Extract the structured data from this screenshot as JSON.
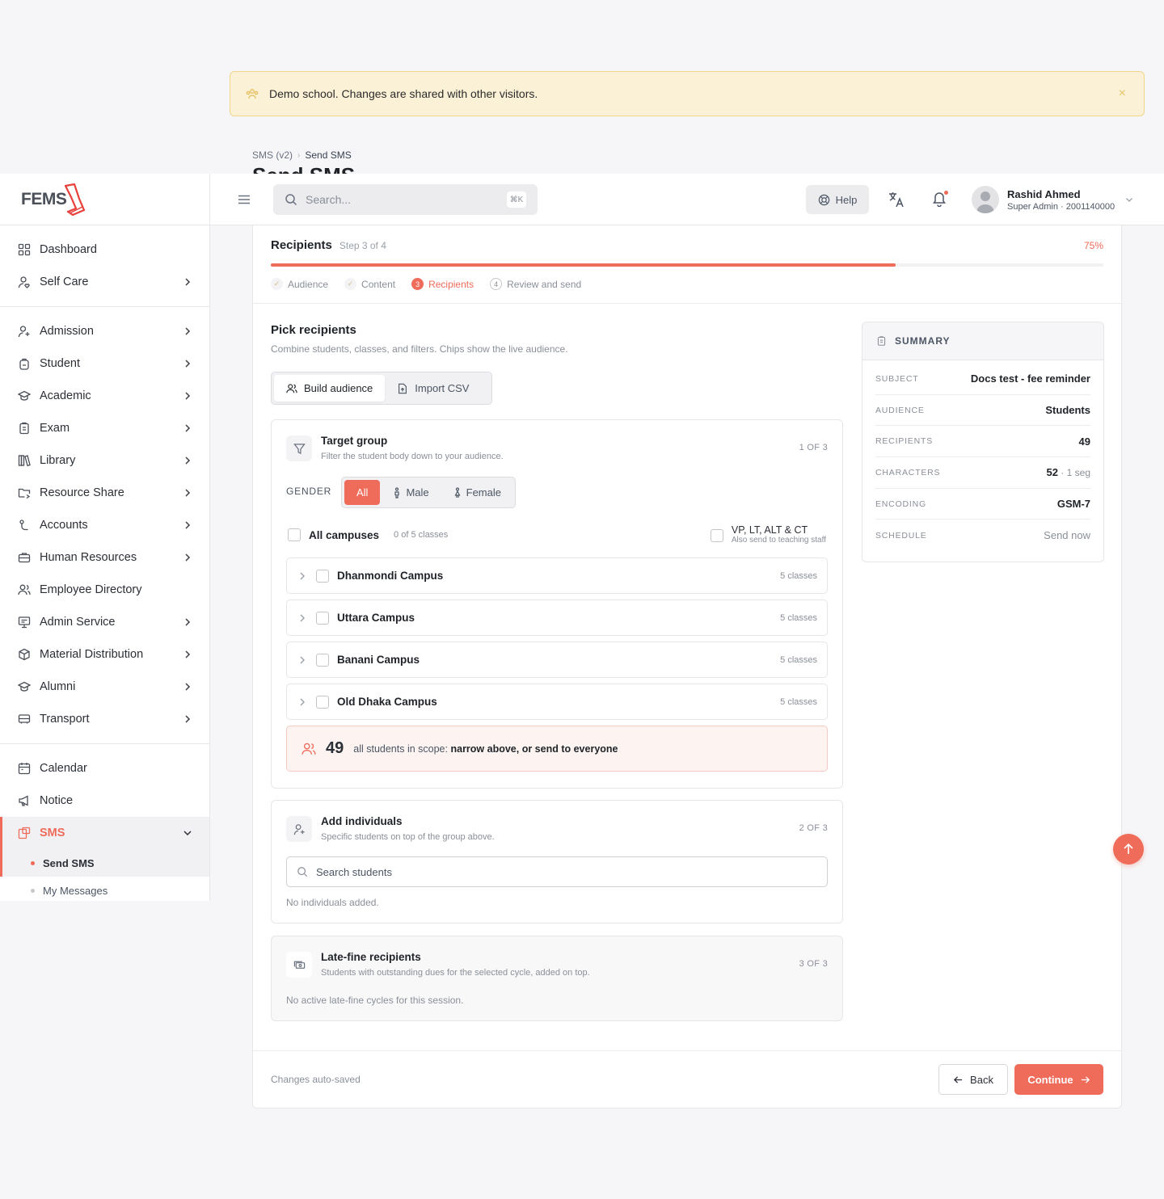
{
  "banner": {
    "text": "Demo school. Changes are shared with other visitors.",
    "close": "×"
  },
  "breadcrumb": {
    "parent": "SMS (v2)",
    "sep": "›",
    "current": "Send SMS"
  },
  "page_title": "Send SMS",
  "brand": {
    "logo_text": "FEMS",
    "accent": "#ef6b5a"
  },
  "sidebar": {
    "groups": [
      [
        {
          "label": "Dashboard",
          "icon": "grid-icon"
        },
        {
          "label": "Self Care",
          "icon": "user-heart-icon"
        }
      ],
      [
        {
          "label": "Admission",
          "icon": "user-plus-icon"
        },
        {
          "label": "Student",
          "icon": "backpack-icon"
        },
        {
          "label": "Academic",
          "icon": "graduation-cap-icon"
        },
        {
          "label": "Exam",
          "icon": "clipboard-icon"
        },
        {
          "label": "Library",
          "icon": "books-icon"
        },
        {
          "label": "Resource Share",
          "icon": "folder-share-icon"
        },
        {
          "label": "Accounts",
          "icon": "coins-icon"
        },
        {
          "label": "Human Resources",
          "icon": "briefcase-icon"
        },
        {
          "label": "Employee Directory",
          "icon": "users-icon"
        },
        {
          "label": "Admin Service",
          "icon": "monitor-icon"
        },
        {
          "label": "Material Distribution",
          "icon": "box-icon"
        },
        {
          "label": "Alumni",
          "icon": "graduation-cap-icon"
        },
        {
          "label": "Transport",
          "icon": "bus-icon"
        }
      ],
      [
        {
          "label": "Calendar",
          "icon": "calendar-icon"
        },
        {
          "label": "Notice",
          "icon": "megaphone-icon"
        }
      ]
    ],
    "sms": {
      "label": "SMS",
      "sub": [
        "Send SMS",
        "My Messages"
      ]
    }
  },
  "topbar": {
    "search_placeholder": "Search...",
    "shortcut": "⌘K",
    "help": "Help",
    "user": {
      "name": "Rashid Ahmed",
      "role": "Super Admin · 2001140000"
    }
  },
  "wizard": {
    "title": "Recipients",
    "step_label": "Step 3 of 4",
    "progress": 75,
    "progress_text": "75%",
    "steps": [
      {
        "n": "✓",
        "label": "Audience",
        "state": "done"
      },
      {
        "n": "✓",
        "label": "Content",
        "state": "done"
      },
      {
        "n": "3",
        "label": "Recipients",
        "state": "current"
      },
      {
        "n": "4",
        "label": "Review and send",
        "state": "todo"
      }
    ]
  },
  "pick": {
    "title": "Pick recipients",
    "subtitle": "Combine students, classes, and filters. Chips show the live audience.",
    "mode_build": "Build audience",
    "mode_import": "Import CSV"
  },
  "target": {
    "title": "Target group",
    "subtitle": "Filter the student body down to your audience.",
    "count": "1 OF 3",
    "gender_label": "GENDER",
    "gender_options": [
      "All",
      "Male",
      "Female"
    ],
    "all_campuses": "All campuses",
    "classes_selected": "0 of 5 classes",
    "staff_label": "VP, LT, ALT & CT",
    "staff_sub": "Also send to teaching staff",
    "campuses": [
      {
        "name": "Dhanmondi Campus",
        "classes": "5 classes"
      },
      {
        "name": "Uttara Campus",
        "classes": "5 classes"
      },
      {
        "name": "Banani Campus",
        "classes": "5 classes"
      },
      {
        "name": "Old Dhaka Campus",
        "classes": "5 classes"
      }
    ],
    "scope_count": "49",
    "scope_text": "all students in scope:",
    "scope_bold": "narrow above, or send to everyone"
  },
  "individuals": {
    "title": "Add individuals",
    "subtitle": "Specific students on top of the group above.",
    "count": "2 OF 3",
    "search_placeholder": "Search students",
    "empty": "No individuals added."
  },
  "latefine": {
    "title": "Late-fine recipients",
    "subtitle": "Students with outstanding dues for the selected cycle, added on top.",
    "count": "3 OF 3",
    "empty": "No active late-fine cycles for this session."
  },
  "summary": {
    "title": "SUMMARY",
    "rows": [
      {
        "k": "SUBJECT",
        "v": "Docs test - fee reminder"
      },
      {
        "k": "AUDIENCE",
        "v": "Students"
      },
      {
        "k": "RECIPIENTS",
        "v": "49"
      },
      {
        "k": "CHARACTERS",
        "v": "52",
        "extra": " · 1 seg"
      },
      {
        "k": "ENCODING",
        "v": "GSM-7"
      },
      {
        "k": "SCHEDULE",
        "v": "Send now"
      }
    ]
  },
  "footer": {
    "autosave": "Changes auto-saved",
    "back": "Back",
    "continue": "Continue"
  }
}
